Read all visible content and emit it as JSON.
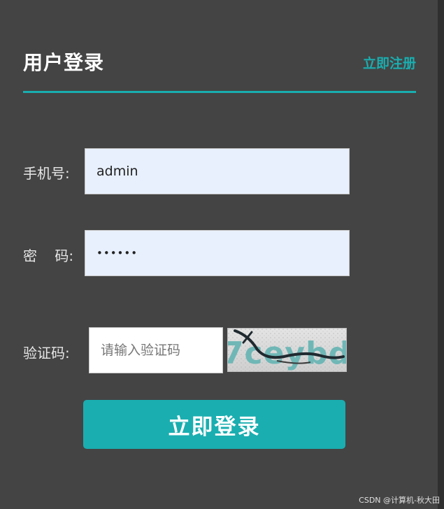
{
  "header": {
    "title": "用户登录",
    "register_link": "立即注册"
  },
  "form": {
    "phone_label": "手机号:",
    "phone_value": "admin",
    "password_label": "密    码:",
    "password_value": "••••••",
    "captcha_label": "验证码:",
    "captcha_placeholder": "请输入验证码",
    "captcha_text": "7ceybd",
    "login_button": "立即登录"
  },
  "watermark": "CSDN @计算机-秋大田",
  "colors": {
    "accent": "#1aaeb0",
    "panel_background": "#444444",
    "input_background": "#e8f0fe"
  }
}
